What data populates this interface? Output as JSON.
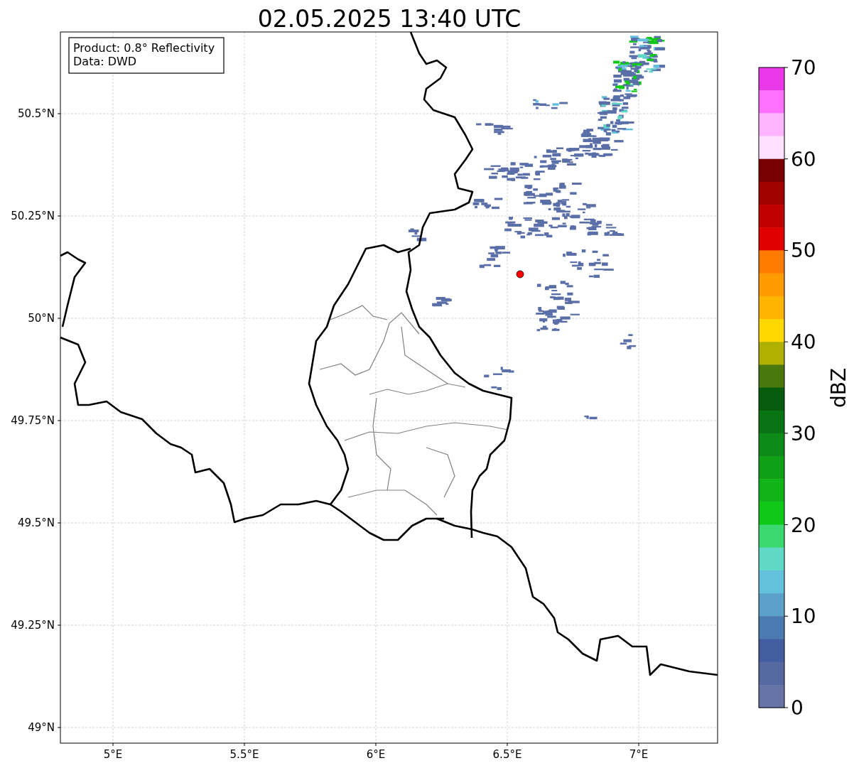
{
  "title": "02.05.2025 13:40 UTC",
  "map": {
    "legend_lines": [
      "Product: 0.8° Reflectivity",
      "Data: DWD"
    ],
    "x_ticks": [
      "5°E",
      "5.5°E",
      "6°E",
      "6.5°E",
      "7°E"
    ],
    "y_ticks": [
      "50.5°N",
      "50.25°N",
      "50°N",
      "49.75°N",
      "49.5°N",
      "49.25°N",
      "49°N"
    ]
  },
  "colorbar": {
    "label": "dBZ",
    "ticks": [
      "70",
      "60",
      "50",
      "40",
      "30",
      "20",
      "10",
      "0"
    ],
    "bins": [
      {
        "color": "#e838e8"
      },
      {
        "color": "#ff70ff"
      },
      {
        "color": "#ffb4ff"
      },
      {
        "color": "#ffe0ff"
      },
      {
        "color": "#780000"
      },
      {
        "color": "#a00000"
      },
      {
        "color": "#c00000"
      },
      {
        "color": "#e00000"
      },
      {
        "color": "#ff7c00"
      },
      {
        "color": "#ff9a00"
      },
      {
        "color": "#ffb400"
      },
      {
        "color": "#ffd800"
      },
      {
        "color": "#b0b000"
      },
      {
        "color": "#4a780c"
      },
      {
        "color": "#065c0c"
      },
      {
        "color": "#0a7414"
      },
      {
        "color": "#0e8a18"
      },
      {
        "color": "#10a018"
      },
      {
        "color": "#10b418"
      },
      {
        "color": "#10c818"
      },
      {
        "color": "#3cd870"
      },
      {
        "color": "#60d8c8"
      },
      {
        "color": "#64c0dc"
      },
      {
        "color": "#5aa0c8"
      },
      {
        "color": "#4a7ab0"
      },
      {
        "color": "#425ea0"
      },
      {
        "color": "#55689f"
      },
      {
        "color": "#6675a6"
      }
    ]
  }
}
